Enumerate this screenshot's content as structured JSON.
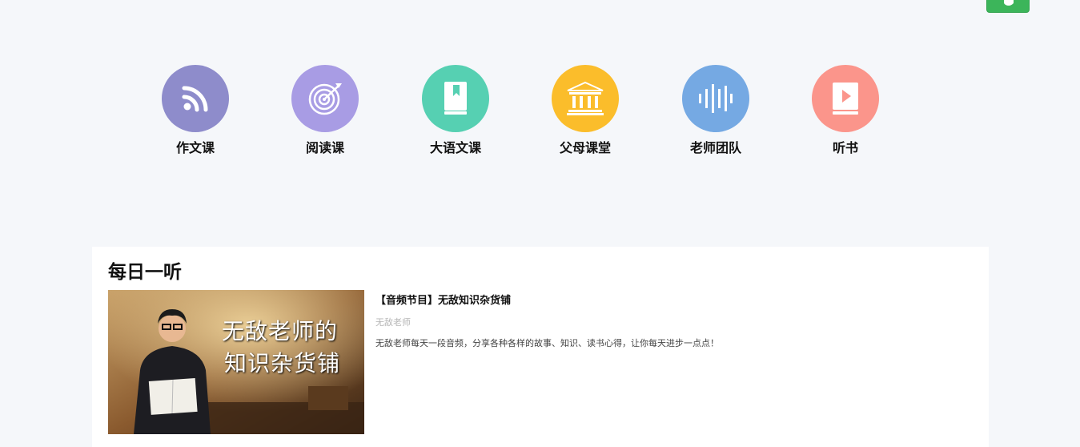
{
  "categories": [
    {
      "label": "作文课",
      "color": "#8e8ccb",
      "icon": "rss-icon"
    },
    {
      "label": "阅读课",
      "color": "#a89ce4",
      "icon": "target-icon"
    },
    {
      "label": "大语文课",
      "color": "#56d0b2",
      "icon": "book-icon"
    },
    {
      "label": "父母课堂",
      "color": "#fbbd2b",
      "icon": "classroom-building-icon"
    },
    {
      "label": "老师团队",
      "color": "#75a9e3",
      "icon": "sound-wave-icon"
    },
    {
      "label": "听书",
      "color": "#fb958b",
      "icon": "play-book-icon"
    }
  ],
  "daily": {
    "title": "每日一听",
    "program": {
      "title": "【音频节目】无敌知识杂货铺",
      "author": "无敌老师",
      "desc": "无敌老师每天一段音频，分享各种各样的故事、知识、读书心得，让你每天进步一点点！",
      "thumb_line1": "无敌老师的",
      "thumb_line2": "知识杂货铺"
    }
  }
}
